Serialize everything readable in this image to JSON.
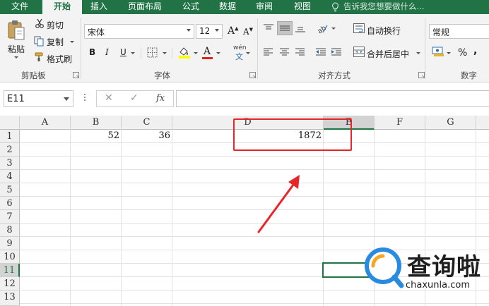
{
  "tabs": [
    "文件",
    "开始",
    "插入",
    "页面布局",
    "公式",
    "数据",
    "审阅",
    "视图"
  ],
  "tell_me": "告诉我您想要做什么...",
  "clipboard": {
    "paste": "粘贴",
    "cut": "剪切",
    "copy": "复制",
    "format_painter": "格式刷",
    "label": "剪贴板"
  },
  "font": {
    "name": "宋体",
    "size": "12",
    "bold": "B",
    "italic": "I",
    "underline": "U",
    "grow": "A",
    "shrink": "A",
    "font_color": "A",
    "phonetic": "wén",
    "phonetic_sub": "文",
    "label": "字体"
  },
  "alignment": {
    "wrap": "自动换行",
    "merge": "合并后居中",
    "label": "对齐方式"
  },
  "number": {
    "format": "常规",
    "percent": "%",
    "label": "数字"
  },
  "formula_bar": {
    "name_box": "E11",
    "cancel": "✕",
    "enter": "✓",
    "fx": "fx",
    "value": ""
  },
  "sheet": {
    "columns": [
      "A",
      "B",
      "C",
      "D",
      "E",
      "F",
      "G"
    ],
    "rows": [
      "1",
      "2",
      "3",
      "4",
      "5",
      "6",
      "7",
      "8",
      "9",
      "10",
      "11",
      "12",
      "13"
    ],
    "selected_cell": "E11",
    "cells": {
      "B1": "52",
      "C1": "36",
      "D1": "1872"
    }
  },
  "watermark": {
    "brand": "查询啦",
    "url": "chaxunla.com"
  },
  "colors": {
    "excel_green": "#217346",
    "highlight_red": "#e8262a",
    "watermark_blue": "#2a8ae0",
    "watermark_orange": "#f5a623"
  }
}
